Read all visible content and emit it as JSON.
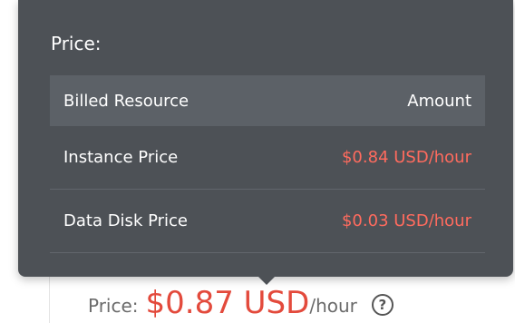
{
  "tooltip": {
    "title": "Price:",
    "columns": {
      "resource": "Billed Resource",
      "amount": "Amount"
    },
    "rows": [
      {
        "resource": "Instance Price",
        "amount": "$0.84 USD/hour"
      },
      {
        "resource": "Data Disk Price",
        "amount": "$0.03 USD/hour"
      }
    ]
  },
  "summary": {
    "label": "Price:",
    "value": "$0.87 USD",
    "unit": "/hour",
    "help_icon": "question-circle-icon"
  },
  "colors": {
    "tooltip_bg": "#4d5156",
    "header_bg": "#5c6167",
    "price_red": "#ff6b5e",
    "total_red": "#e34a3c"
  }
}
